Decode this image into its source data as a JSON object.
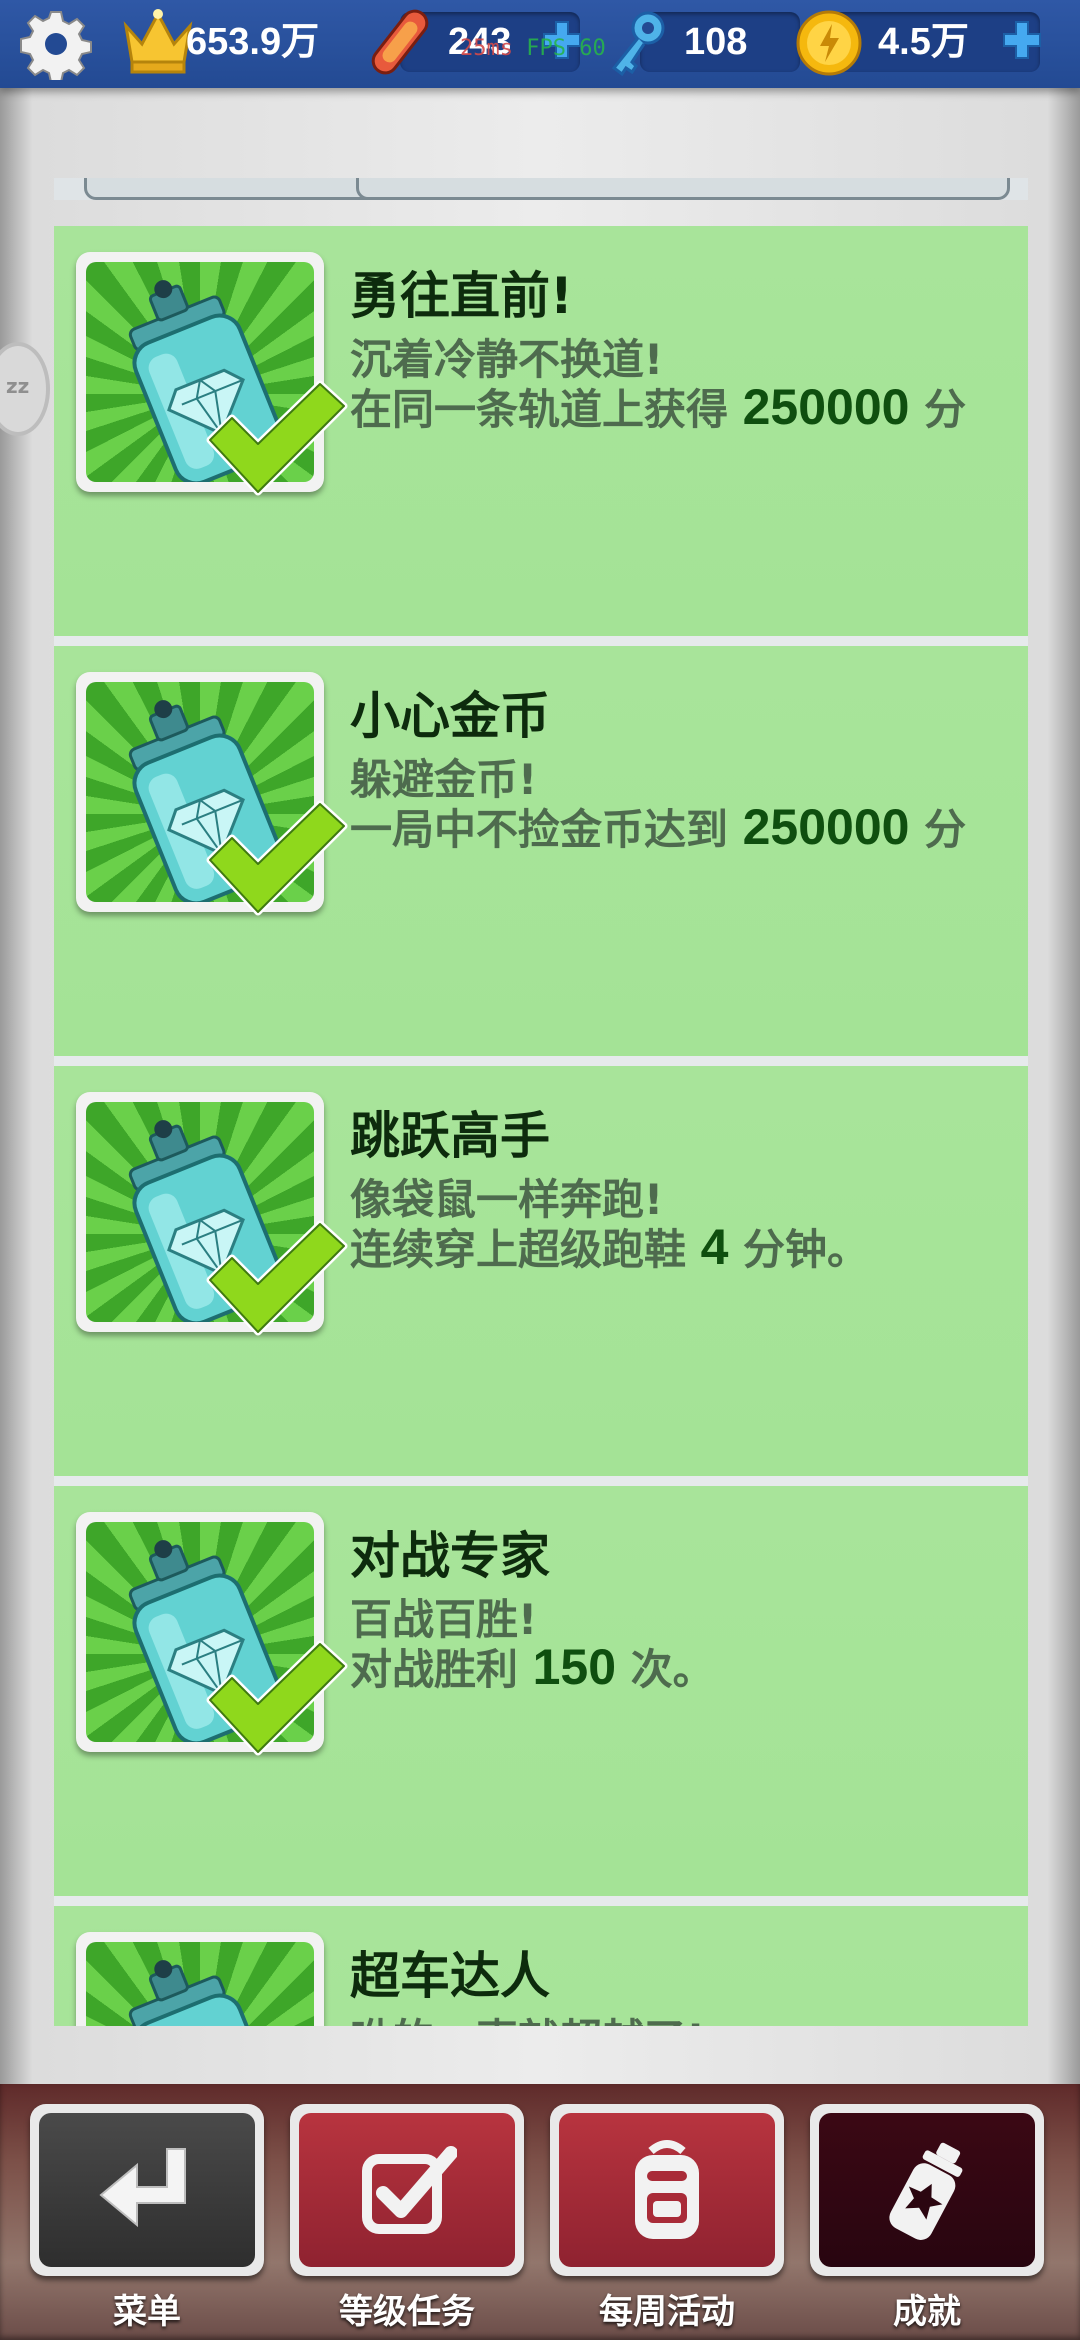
{
  "topbar": {
    "settings_icon": "gear-icon",
    "score": "653.9万",
    "hoverboards": "243",
    "keys": "108",
    "coins": "4.5万",
    "perf_latency": "25ms",
    "perf_fps": "FPS 60"
  },
  "side_tab": {
    "label": "zz"
  },
  "achievements": [
    {
      "title": "勇往直前!",
      "line1": "沉着冷静不换道!",
      "line2_prefix": "在同一条轨道上获得 ",
      "line2_value": "250000",
      "line2_suffix": " 分",
      "completed": true,
      "icon": "spray-can-icon"
    },
    {
      "title": "小心金币",
      "line1": "躲避金币!",
      "line2_prefix": " 一局中不捡金币达到 ",
      "line2_value": "250000",
      "line2_suffix": " 分",
      "completed": true,
      "icon": "spray-can-icon"
    },
    {
      "title": "跳跃高手",
      "line1": "像袋鼠一样奔跑!",
      "line2_prefix": "连续穿上超级跑鞋 ",
      "line2_value": "4",
      "line2_suffix": " 分钟。",
      "completed": true,
      "icon": "spray-can-icon"
    },
    {
      "title": "对战专家",
      "line1": "百战百胜!",
      "line2_prefix": "对战胜利 ",
      "line2_value": "150",
      "line2_suffix": " 次。",
      "completed": true,
      "icon": "spray-can-icon"
    },
    {
      "title": "超车达人",
      "line1": "咻的一声就超越了!",
      "line2_prefix": "",
      "line2_value": "",
      "line2_suffix": "",
      "completed": false,
      "icon": "spray-can-icon"
    }
  ],
  "bottom_nav": [
    {
      "label": "菜单",
      "icon": "return-arrow-icon",
      "style": "dark"
    },
    {
      "label": "等级任务",
      "icon": "checkbox-icon",
      "style": "red"
    },
    {
      "label": "每周活动",
      "icon": "backpack-icon",
      "style": "red"
    },
    {
      "label": "成就",
      "icon": "spray-can-star-icon",
      "style": "maroon",
      "active": true
    }
  ],
  "colors": {
    "topbar": "#2f58a6",
    "card_bg": "#a6e398",
    "title_text": "#0d2b0d",
    "desc_text": "#4e6b4e",
    "value_text": "#0f4f0f"
  }
}
